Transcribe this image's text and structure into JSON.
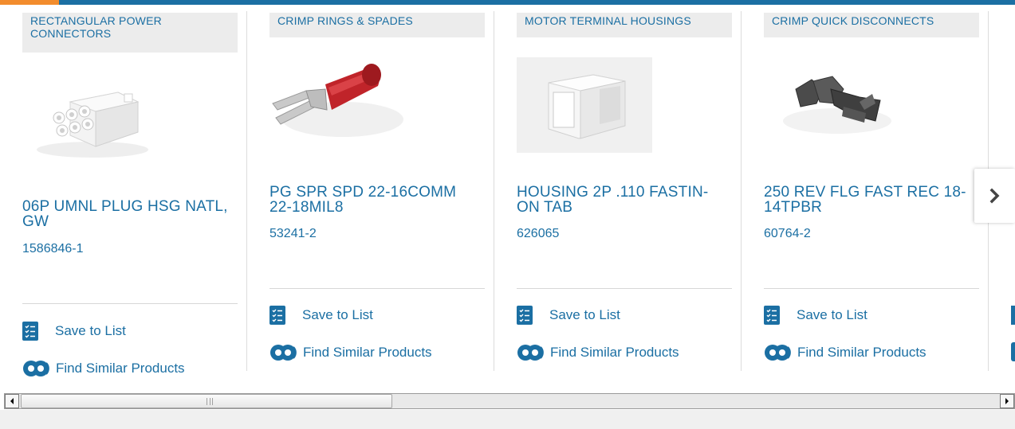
{
  "products": [
    {
      "category": "RECTANGULAR POWER CONNECTORS",
      "name": "06P UMNL PLUG HSG NATL, GW",
      "part_number": "1586846-1",
      "image": "rectangular-connector-image"
    },
    {
      "category": "CRIMP RINGS & SPADES",
      "name": "PG SPR SPD 22-16COMM 22-18MIL8",
      "part_number": "53241-2",
      "image": "crimp-spade-image"
    },
    {
      "category": "MOTOR TERMINAL HOUSINGS",
      "name": "HOUSING 2P .110 FASTIN-ON TAB",
      "part_number": "626065",
      "image": "terminal-housing-image"
    },
    {
      "category": "CRIMP QUICK DISCONNECTS",
      "name": "250 REV FLG FAST REC 18-14TPBR",
      "part_number": "60764-2",
      "image": "quick-disconnect-image"
    }
  ],
  "actions": {
    "save_label": "Save to List",
    "similar_label": "Find Similar Products"
  },
  "icons": {
    "save": "checklist-icon",
    "similar": "gear-pair-icon",
    "next": "chevron-right-icon"
  },
  "colors": {
    "brand_blue": "#1b6fa3",
    "accent_orange": "#f28c2d",
    "category_bg": "#ececec"
  }
}
